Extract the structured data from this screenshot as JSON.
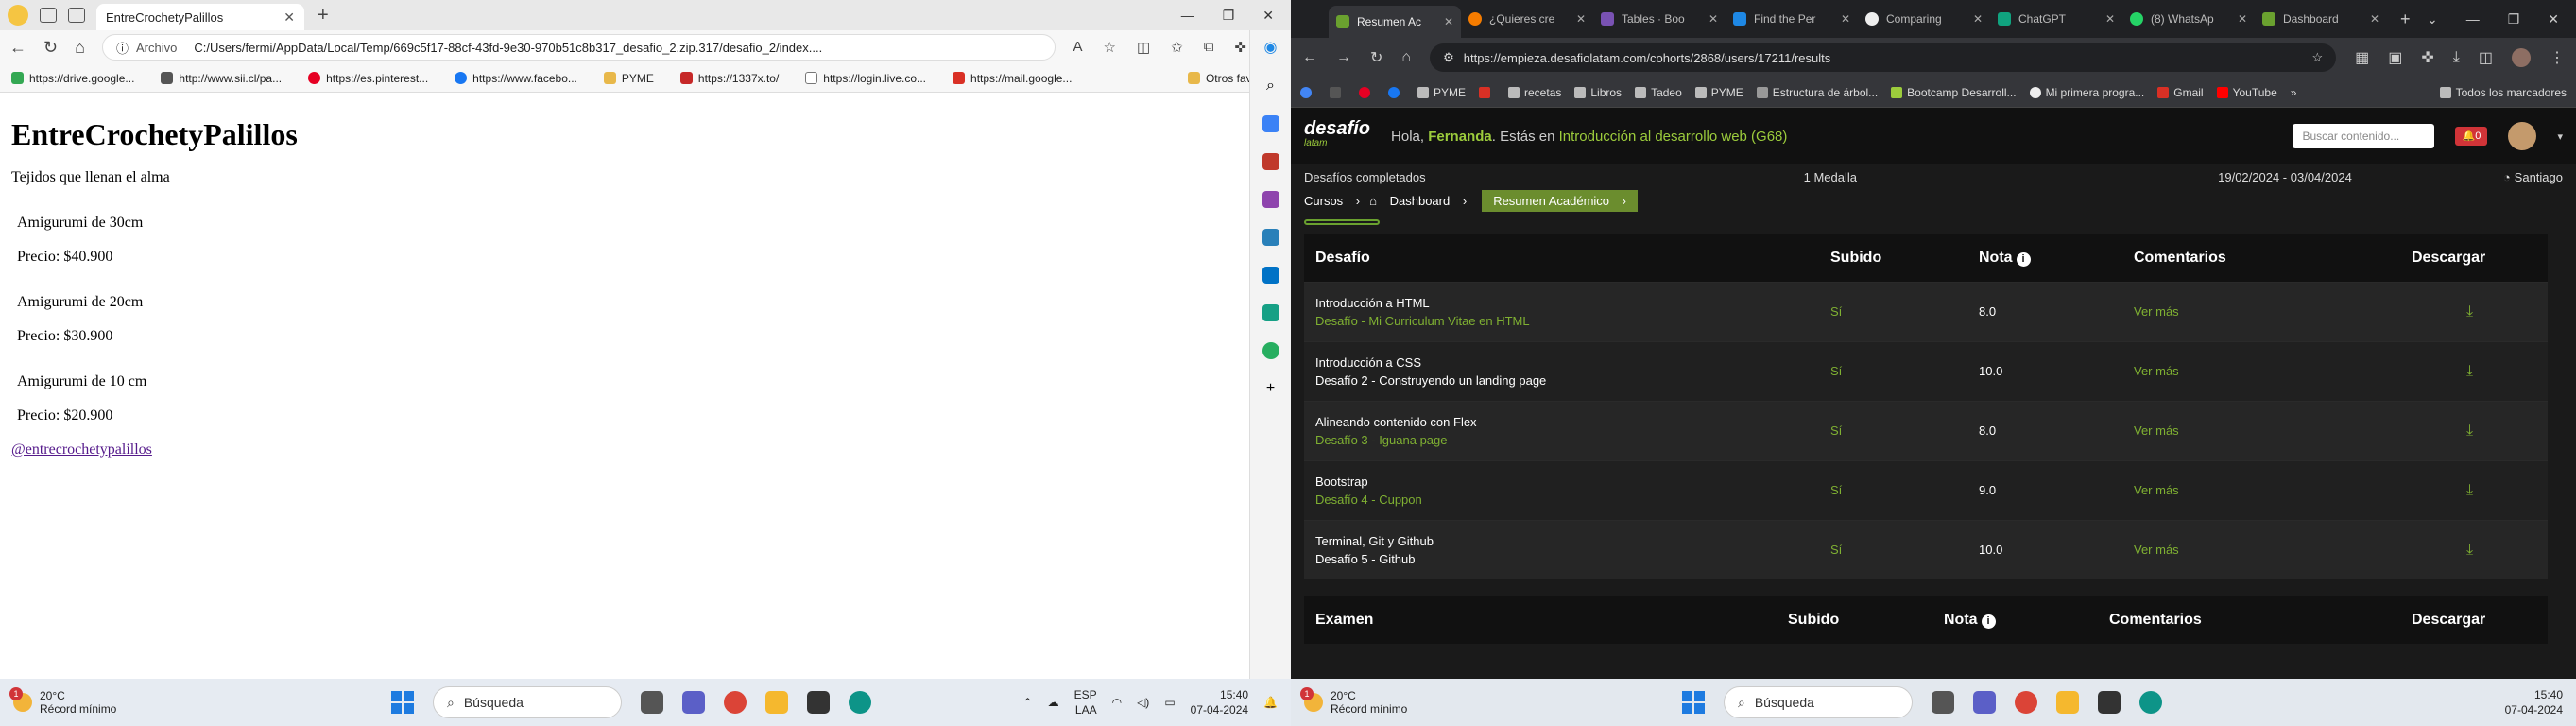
{
  "edge": {
    "tab_title": "EntreCrochetyPalillos",
    "address_label": "Archivo",
    "url": "C:/Users/fermi/AppData/Local/Temp/669c5f17-88cf-43fd-9e30-970b51c8b317_desafio_2.zip.317/desafio_2/index....",
    "favorites": [
      "https://drive.google...",
      "http://www.sii.cl/pa...",
      "https://es.pinterest...",
      "https://www.facebo...",
      "PYME",
      "https://1337x.to/",
      "https://login.live.co...",
      "https://mail.google..."
    ],
    "favorites_end": "Otros favoritos",
    "page": {
      "title": "EntreCrochetyPalillos",
      "tagline": "Tejidos que llenan el alma",
      "products": [
        {
          "name": "Amigurumi de 30cm",
          "price": "Precio: $40.900"
        },
        {
          "name": "Amigurumi de 20cm",
          "price": "Precio: $30.900"
        },
        {
          "name": "Amigurumi de 10 cm",
          "price": "Precio: $20.900"
        }
      ],
      "link": "@entrecrochetypalillos"
    }
  },
  "chrome": {
    "tabs": [
      "Resumen Ac",
      "¿Quieres cre",
      "Tables · Boo",
      "Find the Per",
      "Comparing",
      "ChatGPT",
      "(8) WhatsAp",
      "Dashboard"
    ],
    "url": "https://empieza.desafiolatam.com/cohorts/2868/users/17211/results",
    "bookmarks": [
      "PYME",
      "recetas",
      "Libros",
      "Tadeo",
      "PYME",
      "Estructura de árbol...",
      "Bootcamp Desarroll...",
      "Mi primera progra...",
      "Gmail",
      "YouTube"
    ],
    "bookmarks_end": "Todos los marcadores"
  },
  "site": {
    "logo": "desafío",
    "logo_sub": "latam_",
    "greet_pre": "Hola, ",
    "user": "Fernanda",
    "greet_mid": ". Estás en ",
    "course": "Introducción al desarrollo web (G68)",
    "search_placeholder": "Buscar contenido...",
    "bell_count": "0",
    "completed": "Desafíos completados",
    "medal": "1 Medalla",
    "dates": "19/02/2024 - 03/04/2024",
    "city": "Santiago",
    "crumbs": [
      "Cursos",
      "Dashboard",
      "Resumen Académico"
    ],
    "headers": [
      "Desafío",
      "Subido",
      "Nota",
      "Comentarios",
      "Descargar"
    ],
    "rows": [
      {
        "title": "Introducción a HTML",
        "sub": "Desafío - Mi Curriculum Vitae en HTML",
        "subido": "Sí",
        "nota": "8.0",
        "com": "Ver más",
        "white": false
      },
      {
        "title": "Introducción a CSS",
        "sub": "Desafío 2 - Construyendo un landing page",
        "subido": "Sí",
        "nota": "10.0",
        "com": "Ver más",
        "white": true
      },
      {
        "title": "Alineando contenido con Flex",
        "sub": "Desafío 3 - Iguana page",
        "subido": "Sí",
        "nota": "8.0",
        "com": "Ver más",
        "white": false
      },
      {
        "title": "Bootstrap",
        "sub": "Desafío 4 - Cuppon",
        "subido": "Sí",
        "nota": "9.0",
        "com": "Ver más",
        "white": false
      },
      {
        "title": "Terminal, Git y Github",
        "sub": "Desafío 5 - Github",
        "subido": "Sí",
        "nota": "10.0",
        "com": "Ver más",
        "white": true
      }
    ],
    "exam_headers": [
      "Examen",
      "Subido",
      "Nota",
      "Comentarios",
      "Descargar"
    ]
  },
  "taskbar": {
    "temp": "20°C",
    "weather": "Récord mínimo",
    "alert": "1",
    "search": "Búsqueda",
    "lang": "ESP",
    "lang2": "LAA",
    "time": "15:40",
    "date": "07-04-2024"
  }
}
